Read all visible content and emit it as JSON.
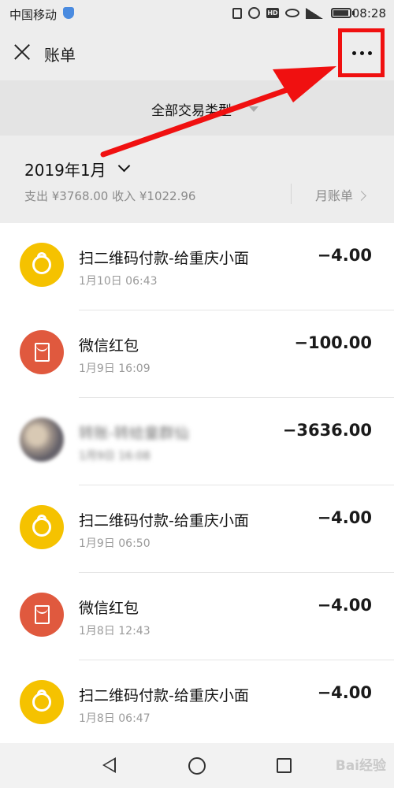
{
  "status_bar": {
    "carrier": "中国移动",
    "hd": "HD",
    "time": "08:28"
  },
  "header": {
    "title": "账单"
  },
  "filter": {
    "label": "全部交易类型"
  },
  "summary": {
    "month": "2019年1月",
    "totals": "支出 ¥3768.00 收入 ¥1022.96",
    "monthly_link": "月账单"
  },
  "transactions": [
    {
      "icon": "qr-payment-icon",
      "title": "扫二维码付款-给重庆小面",
      "time": "1月10日 06:43",
      "amount": "−4.00"
    },
    {
      "icon": "red-packet-icon",
      "title": "微信红包",
      "time": "1月9日 16:09",
      "amount": "−100.00"
    },
    {
      "icon": "avatar-blurred",
      "title": "转账-转给童群仙",
      "time": "1月9日 16:08",
      "amount": "−3636.00"
    },
    {
      "icon": "qr-payment-icon",
      "title": "扫二维码付款-给重庆小面",
      "time": "1月9日 06:50",
      "amount": "−4.00"
    },
    {
      "icon": "red-packet-icon",
      "title": "微信红包",
      "time": "1月8日 12:43",
      "amount": "−4.00"
    },
    {
      "icon": "qr-payment-icon",
      "title": "扫二维码付款-给重庆小面",
      "time": "1月8日 06:47",
      "amount": "−4.00"
    }
  ],
  "watermark": "Bai经验",
  "colors": {
    "annotation_red": "#f01010",
    "qr_yellow": "#f5c200",
    "red_packet": "#e0593e"
  }
}
